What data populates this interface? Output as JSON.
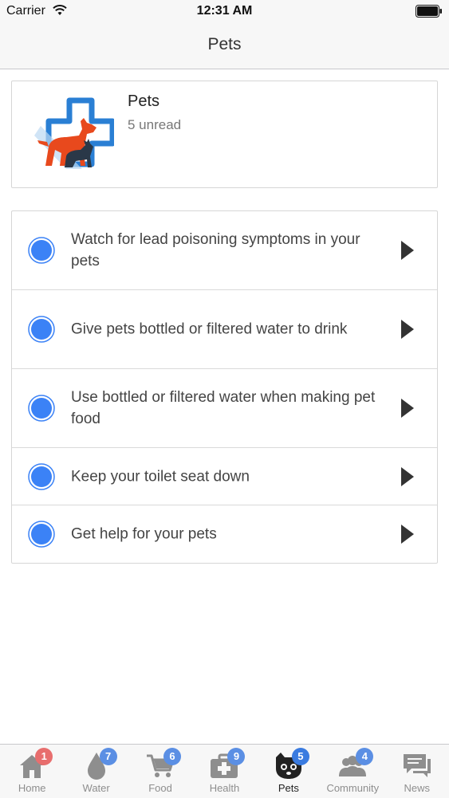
{
  "status_bar": {
    "carrier": "Carrier",
    "time": "12:31 AM"
  },
  "nav": {
    "title": "Pets"
  },
  "header": {
    "title": "Pets",
    "subtitle": "5 unread"
  },
  "colors": {
    "accent_blue": "#3b82f6",
    "badge_red": "#e86e6e",
    "badge_blue": "#5b8fe4",
    "logo_orange": "#e8491d",
    "logo_blue": "#2a7fd4"
  },
  "items": [
    {
      "label": "Watch for lead poisoning symptoms in your pets",
      "icon": "unread-dot-icon"
    },
    {
      "label": "Give pets bottled or filtered water to drink",
      "icon": "unread-dot-icon"
    },
    {
      "label": "Use bottled or filtered water when making pet food",
      "icon": "unread-dot-icon"
    },
    {
      "label": "Keep your toilet seat down",
      "icon": "unread-dot-icon"
    },
    {
      "label": "Get help for your pets",
      "icon": "unread-dot-icon"
    }
  ],
  "tabs": [
    {
      "label": "Home",
      "badge": "1",
      "icon": "home-icon"
    },
    {
      "label": "Water",
      "badge": "7",
      "icon": "water-drop-icon"
    },
    {
      "label": "Food",
      "badge": "6",
      "icon": "cart-icon"
    },
    {
      "label": "Health",
      "badge": "9",
      "icon": "medkit-icon"
    },
    {
      "label": "Pets",
      "badge": "5",
      "icon": "pet-icon"
    },
    {
      "label": "Community",
      "badge": "4",
      "icon": "people-icon"
    },
    {
      "label": "News",
      "badge": "",
      "icon": "chat-icon"
    }
  ]
}
